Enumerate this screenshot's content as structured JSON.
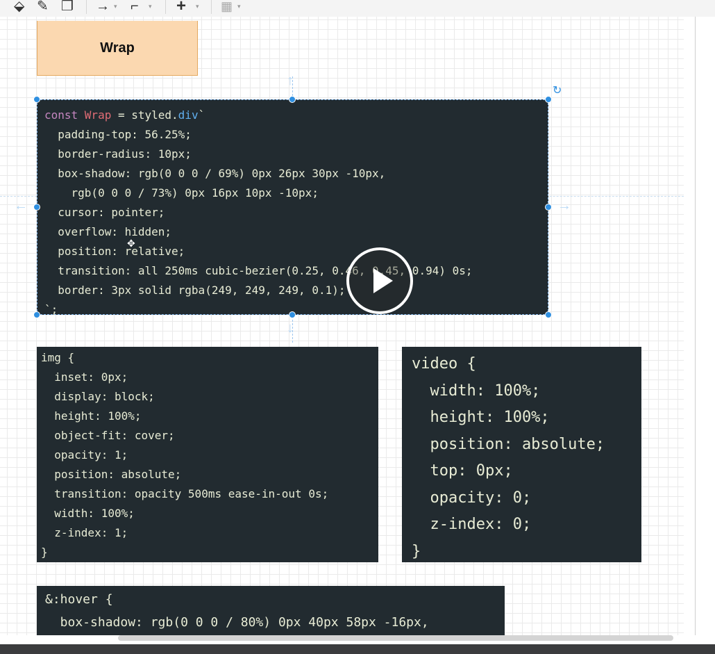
{
  "toolbar": {
    "icons": [
      "fill-icon",
      "line-color-icon",
      "shadow-icon",
      "connector-icon",
      "waypoint-icon",
      "insert-plus-icon",
      "table-icon"
    ],
    "symbols": {
      "fill": "⬙",
      "pen": "✎",
      "shadow": "❐",
      "connector": "→",
      "waypoint": "⌐",
      "plus": "+",
      "table": "▦",
      "caret": "▾"
    }
  },
  "canvas": {
    "wrap_label": "Wrap",
    "styled_code": [
      {
        "segments": [
          {
            "t": "const ",
            "c": "kw"
          },
          {
            "t": "Wrap",
            "c": "nm"
          },
          {
            "t": " = ",
            "c": "op"
          },
          {
            "t": "styled.",
            "c": "fn"
          },
          {
            "t": "div",
            "c": "tg"
          },
          {
            "t": "`",
            "c": "op"
          }
        ]
      },
      {
        "segments": [
          {
            "t": "  padding-top: 56.25%;",
            "c": ""
          }
        ]
      },
      {
        "segments": [
          {
            "t": "  border-radius: 10px;",
            "c": ""
          }
        ]
      },
      {
        "segments": [
          {
            "t": "  box-shadow: rgb(0 0 0 / 69%) 0px 26px 30px -10px,",
            "c": ""
          }
        ]
      },
      {
        "segments": [
          {
            "t": "    rgb(0 0 0 / 73%) 0px 16px 10px -10px;",
            "c": ""
          }
        ]
      },
      {
        "segments": [
          {
            "t": "  cursor: pointer;",
            "c": ""
          }
        ]
      },
      {
        "segments": [
          {
            "t": "  overflow: hidden;",
            "c": ""
          }
        ]
      },
      {
        "segments": [
          {
            "t": "  position: relative;",
            "c": ""
          }
        ]
      },
      {
        "segments": [
          {
            "t": "  transition: all 250ms cubic-bezier(0.25, 0.46, 0.45, 0.94) 0s;",
            "c": ""
          }
        ]
      },
      {
        "segments": [
          {
            "t": "  border: 3px solid rgba(249, 249, 249, 0.1);",
            "c": ""
          }
        ]
      },
      {
        "segments": [
          {
            "t": "`;",
            "c": ""
          }
        ]
      }
    ],
    "img_code": [
      "img {",
      "  inset: 0px;",
      "  display: block;",
      "  height: 100%;",
      "  object-fit: cover;",
      "  opacity: 1;",
      "  position: absolute;",
      "  transition: opacity 500ms ease-in-out 0s;",
      "  width: 100%;",
      "  z-index: 1;",
      "}"
    ],
    "video_code": [
      "video {",
      "  width: 100%;",
      "  height: 100%;",
      "  position: absolute;",
      "  top: 0px;",
      "  opacity: 0;",
      "  z-index: 0;",
      "}"
    ],
    "hover_code": [
      "&:hover {",
      "  box-shadow: rgb(0 0 0 / 80%) 0px 40px 58px -16px,"
    ]
  },
  "colors": {
    "code_bg": "#222b30",
    "selection": "#2f8fe0",
    "wrap_fill": "#fbd8b0",
    "wrap_border": "#e3a85f"
  }
}
